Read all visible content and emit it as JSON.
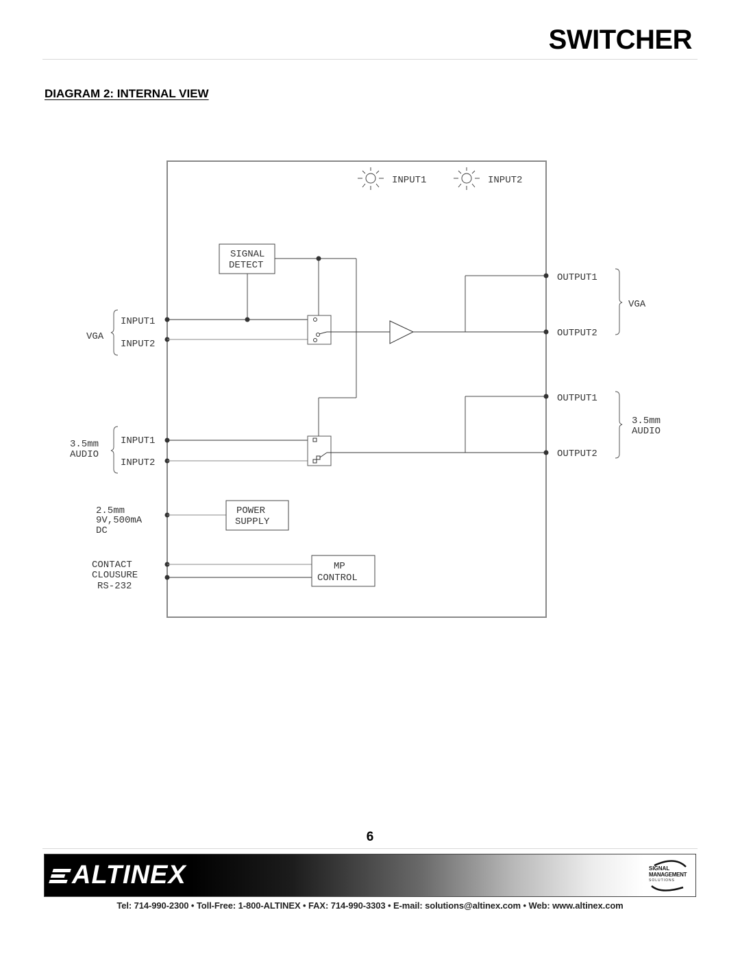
{
  "header": {
    "product_title": "SWITCHER",
    "section_heading": "DIAGRAM 2: INTERNAL VIEW"
  },
  "diagram": {
    "indicators": [
      {
        "icon": "led-sun-icon",
        "label": "INPUT1"
      },
      {
        "icon": "led-sun-icon",
        "label": "INPUT2"
      }
    ],
    "blocks": {
      "signal_detect": [
        "SIGNAL",
        "DETECT"
      ],
      "power_supply": [
        "POWER",
        "SUPPLY"
      ],
      "mp_control": [
        "MP",
        "CONTROL"
      ]
    },
    "vga_inputs": {
      "group_label": "VGA",
      "ports": [
        "INPUT1",
        "INPUT2"
      ]
    },
    "audio_inputs": {
      "group_label": [
        "3.5mm",
        "AUDIO"
      ],
      "ports": [
        "INPUT1",
        "INPUT2"
      ]
    },
    "power_input": [
      "2.5mm",
      "9V,500mA",
      "DC"
    ],
    "control_input": [
      "CONTACT",
      "CLOUSURE",
      "RS-232"
    ],
    "vga_outputs": {
      "group_label": "VGA",
      "ports": [
        "OUTPUT1",
        "OUTPUT2"
      ]
    },
    "audio_outputs": {
      "group_label": [
        "3.5mm",
        "AUDIO"
      ],
      "ports": [
        "OUTPUT1",
        "OUTPUT2"
      ]
    }
  },
  "footer": {
    "page_number": "6",
    "brand": "ALTINEX",
    "badge": [
      "SIGNAL",
      "MANAGEMENT",
      "SOLUTIONS"
    ],
    "contact": "Tel: 714-990-2300 • Toll-Free: 1-800-ALTINEX • FAX: 714-990-3303 • E-mail: solutions@altinex.com • Web: www.altinex.com"
  }
}
